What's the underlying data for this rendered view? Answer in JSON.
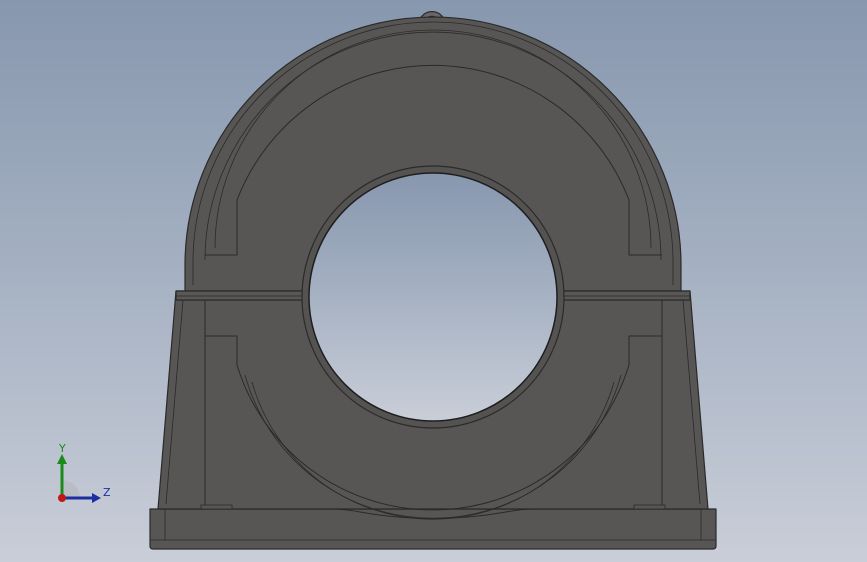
{
  "viewport": {
    "background_top": "#8797ae",
    "background_bottom": "#c9ced8"
  },
  "model": {
    "name": "pillow-block-bearing-housing",
    "body_color": "#585654",
    "edge_color": "#2a2a2a",
    "bore_color": "background"
  },
  "triad": {
    "y_label": "Y",
    "z_label": "Z",
    "y_color": "#1a8a1a",
    "z_color": "#1d2fa0",
    "x_color": "#c01818"
  }
}
